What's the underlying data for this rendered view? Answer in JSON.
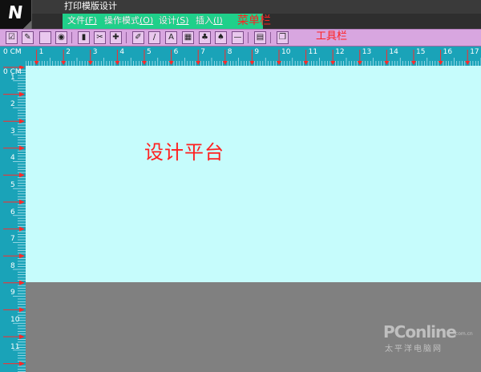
{
  "window": {
    "title": "打印模版设计",
    "app_icon": "app-logo-icon"
  },
  "menubar": {
    "items": [
      {
        "text": "文件",
        "key": "(F)"
      },
      {
        "text": "操作模式",
        "key": "(O)"
      },
      {
        "text": "设计",
        "key": "(S)"
      },
      {
        "text": "插入",
        "key": "(I)"
      }
    ],
    "annotation": "菜单栏"
  },
  "toolbar": {
    "annotation": "工具栏",
    "buttons": [
      {
        "icon": "checklist-icon"
      },
      {
        "icon": "edit-document-icon"
      },
      {
        "icon": "save-icon"
      },
      {
        "icon": "disk-icon"
      },
      {
        "icon": "lock-icon"
      },
      {
        "icon": "cut-icon"
      },
      {
        "icon": "cross-icon"
      },
      {
        "icon": "pencil-edit-icon"
      },
      {
        "icon": "brush-icon"
      },
      {
        "icon": "text-box-icon"
      },
      {
        "icon": "image-icon"
      },
      {
        "icon": "stamp-icon"
      },
      {
        "icon": "stack-icon"
      },
      {
        "icon": "horizontal-line-icon"
      },
      {
        "icon": "grid-icon"
      },
      {
        "icon": "page-setup-icon"
      }
    ]
  },
  "ruler": {
    "unit_label": "0 CM",
    "top_numbers": [
      "1",
      "2",
      "3",
      "4",
      "5",
      "6",
      "7",
      "8",
      "9",
      "10",
      "11",
      "12",
      "13",
      "14",
      "15",
      "16",
      "17"
    ],
    "left_numbers": [
      "1",
      "2",
      "3",
      "4",
      "5",
      "6",
      "7",
      "8",
      "9",
      "10",
      "11"
    ]
  },
  "canvas": {
    "label": "设计平台",
    "background": "#c6fcfc"
  },
  "colors": {
    "menu_green": "#1fd08a",
    "toolbar_pink": "#d8a6e0",
    "ruler_teal": "#1aa3b8",
    "annotation_red": "#ff2020",
    "workspace_gray": "#808080"
  },
  "watermark": {
    "main": "PConline",
    "suffix": ".com.cn",
    "sub": "太平洋电脑网"
  }
}
